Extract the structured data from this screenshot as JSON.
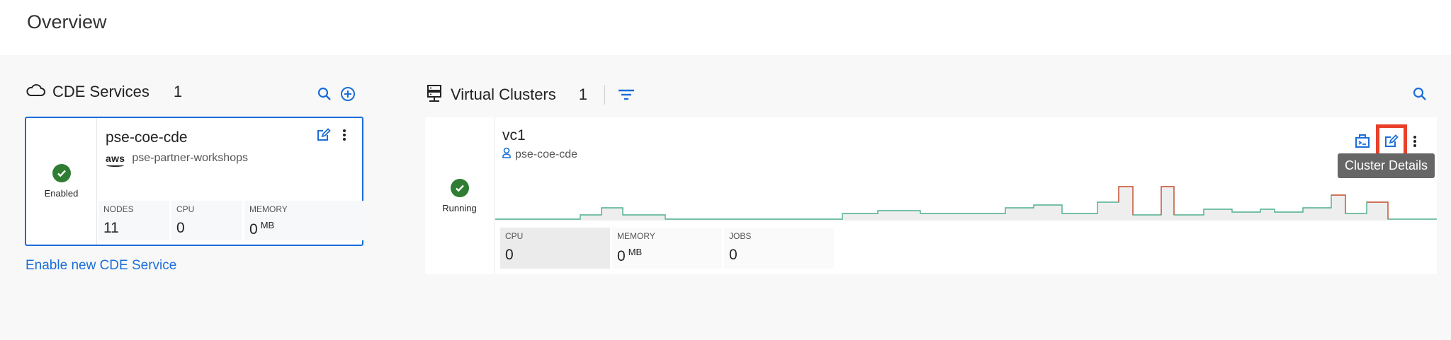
{
  "page": {
    "title": "Overview"
  },
  "services": {
    "title": "CDE Services",
    "count": "1",
    "card": {
      "status": "Enabled",
      "name": "pse-coe-cde",
      "provider": "aws",
      "workspace": "pse-partner-workshops",
      "stats": [
        {
          "label": "NODES",
          "value": "11",
          "unit": ""
        },
        {
          "label": "CPU",
          "value": "0",
          "unit": ""
        },
        {
          "label": "MEMORY",
          "value": "0",
          "unit": "MB"
        }
      ]
    },
    "enable_link": "Enable new CDE Service"
  },
  "clusters": {
    "title": "Virtual Clusters",
    "count": "1",
    "card": {
      "status": "Running",
      "name": "vc1",
      "service": "pse-coe-cde",
      "stats": [
        {
          "label": "CPU",
          "value": "0",
          "unit": ""
        },
        {
          "label": "MEMORY",
          "value": "0",
          "unit": "MB"
        },
        {
          "label": "JOBS",
          "value": "0",
          "unit": ""
        }
      ]
    },
    "tooltip": "Cluster Details"
  },
  "colors": {
    "accent": "#1a6ed8",
    "success": "#2e7d32",
    "highlight": "#e8402a",
    "chart_green": "#4caf8a",
    "chart_red": "#e0533a"
  }
}
